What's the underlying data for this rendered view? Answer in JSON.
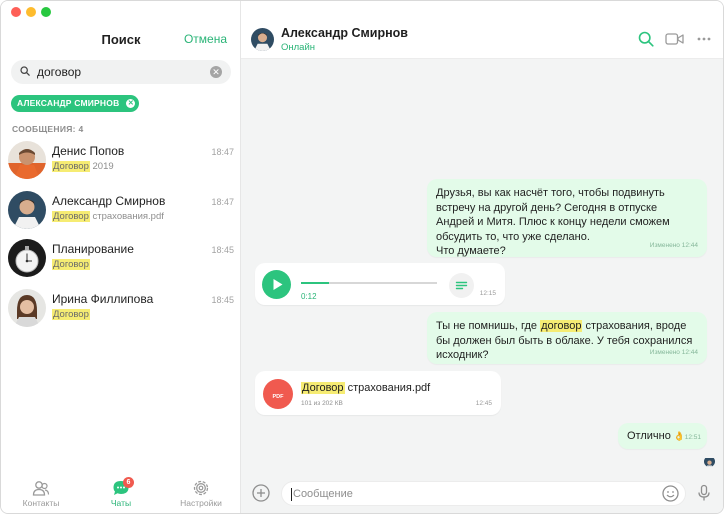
{
  "sidebar": {
    "title": "Поиск",
    "cancel_label": "Отмена",
    "search": {
      "value": "договор",
      "clear_icon": "clear-icon"
    },
    "filter_chip": "АЛЕКСАНДР СМИРНОВ",
    "section_label": "СООБЩЕНИЯ: 4",
    "results": [
      {
        "name": "Денис Попов",
        "highlight": "Договор",
        "rest": " 2019",
        "time": "18:47"
      },
      {
        "name": "Александр Смирнов",
        "highlight": "Договор",
        "rest": " страхования.pdf",
        "time": "18:47"
      },
      {
        "name": "Планирование",
        "highlight": "Договор",
        "rest": "",
        "time": "18:45"
      },
      {
        "name": "Ирина Филлипова",
        "highlight": "Договор",
        "rest": "",
        "time": "18:45"
      }
    ],
    "nav": [
      {
        "label": "Контакты",
        "icon": "contacts-icon"
      },
      {
        "label": "Чаты",
        "icon": "chats-icon",
        "badge": "6"
      },
      {
        "label": "Настройки",
        "icon": "settings-icon"
      }
    ]
  },
  "chat": {
    "contact_name": "Александр Смирнов",
    "status": "Онлайн",
    "messages": [
      {
        "type": "text",
        "text": "Друзья, вы как насчёт того, чтобы подвинуть встречу на другой день? Сегодня в отпуске Андрей и Митя. Плюс к концу недели сможем обсудить то, что уже сделано.",
        "text2": "Что думаете?",
        "meta": "Изменено 12:44"
      },
      {
        "type": "voice",
        "duration": "0:12",
        "time": "12:15"
      },
      {
        "type": "text",
        "before": "Ты не помнишь, где ",
        "highlight": "договор",
        "after": " страхования, вроде бы должен был быть в облаке. У тебя сохранился исходник?",
        "meta": "Изменено 12:44"
      },
      {
        "type": "file",
        "icon_label": "PDF",
        "highlight": "Договор",
        "name_rest": " страхования.pdf",
        "size": "101 из 202 КВ",
        "time": "12:45"
      },
      {
        "type": "text",
        "text": "Отлично",
        "emoji": "👌",
        "time": "12:51"
      }
    ],
    "composer_placeholder": "Сообщение"
  },
  "colors": {
    "accent": "#2cc47e",
    "outgoing_bubble": "#e3fbe9",
    "highlight": "#f6ec73",
    "badge": "#f05a4f"
  }
}
